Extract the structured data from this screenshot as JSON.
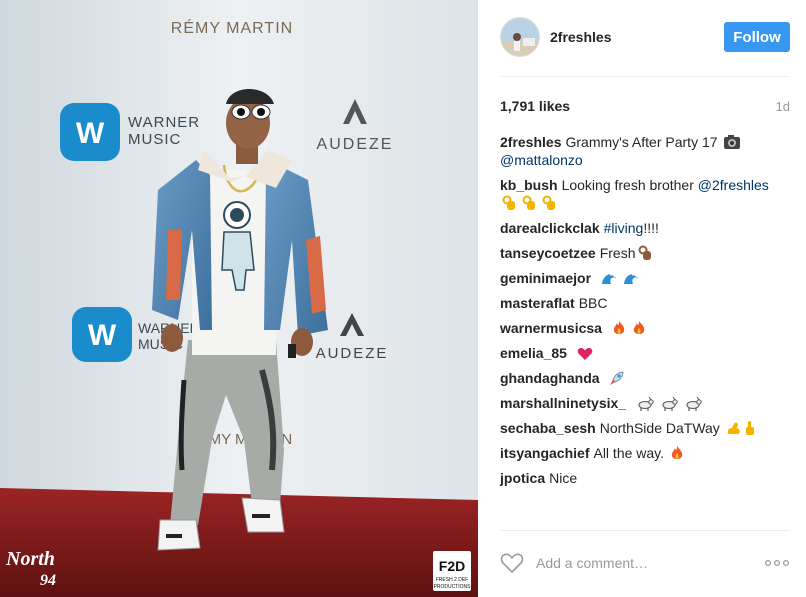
{
  "photo": {
    "wall_brands": {
      "remy_martin": "RÉMY MARTIN",
      "warner_music": "WARNER\nMUSIC",
      "warner_line1": "WARNER",
      "warner_line2": "MUSIC",
      "audeze": "AUDEZE",
      "remy_partial": "RÉMY MARTIN"
    },
    "watermark_left": "North\n94",
    "watermark_left_line1": "North",
    "watermark_left_line2": "94",
    "watermark_right_big": "F2D",
    "watermark_right_small_1": "FRESH 2 DEF",
    "watermark_right_small_2": "PRODUCTIONS"
  },
  "header": {
    "username": "2freshles",
    "follow_label": "Follow"
  },
  "meta": {
    "likes": "1,791 likes",
    "time": "1d"
  },
  "comments": [
    {
      "user": "2freshles",
      "text": "Grammy's After Party 17",
      "emoji": "camera-icon",
      "mention": "@mattalonzo"
    },
    {
      "user": "kb_bush",
      "text": "Looking fresh brother",
      "mention": "@2freshles",
      "emoji": "ok-hand-icon x3"
    },
    {
      "user": "darealclickclak",
      "tag": "#living",
      "text": "!!!!"
    },
    {
      "user": "tanseycoetzee",
      "text": "Fresh",
      "emoji": "ok-hand-icon"
    },
    {
      "user": "geminimaejor",
      "text": "",
      "emoji": "wave-icon x2"
    },
    {
      "user": "masteraflat",
      "text": "BBC"
    },
    {
      "user": "warnermusicsa",
      "text": "",
      "emoji": "fire-icon x2"
    },
    {
      "user": "emelia_85",
      "text": "",
      "emoji": "heart-icon"
    },
    {
      "user": "ghandaghanda",
      "text": "",
      "emoji": "rocket-icon"
    },
    {
      "user": "marshallninetysix_",
      "text": "",
      "emoji": "goat-icon x3"
    },
    {
      "user": "sechaba_sesh",
      "text": "NorthSide DaTWay",
      "emoji": "flex-icon, point-up-icon"
    },
    {
      "user": "itsyangachief",
      "text": "All the way.",
      "emoji": "fire-icon"
    },
    {
      "user": "jpotica",
      "text": "Nice"
    }
  ],
  "footer": {
    "comment_placeholder": "Add a comment…"
  },
  "colors": {
    "accent": "#3897f0",
    "username": "#262626",
    "link": "#003569",
    "muted": "#999999",
    "carpet": "#8c1d1d",
    "warner_blue": "#1b8ccb"
  }
}
